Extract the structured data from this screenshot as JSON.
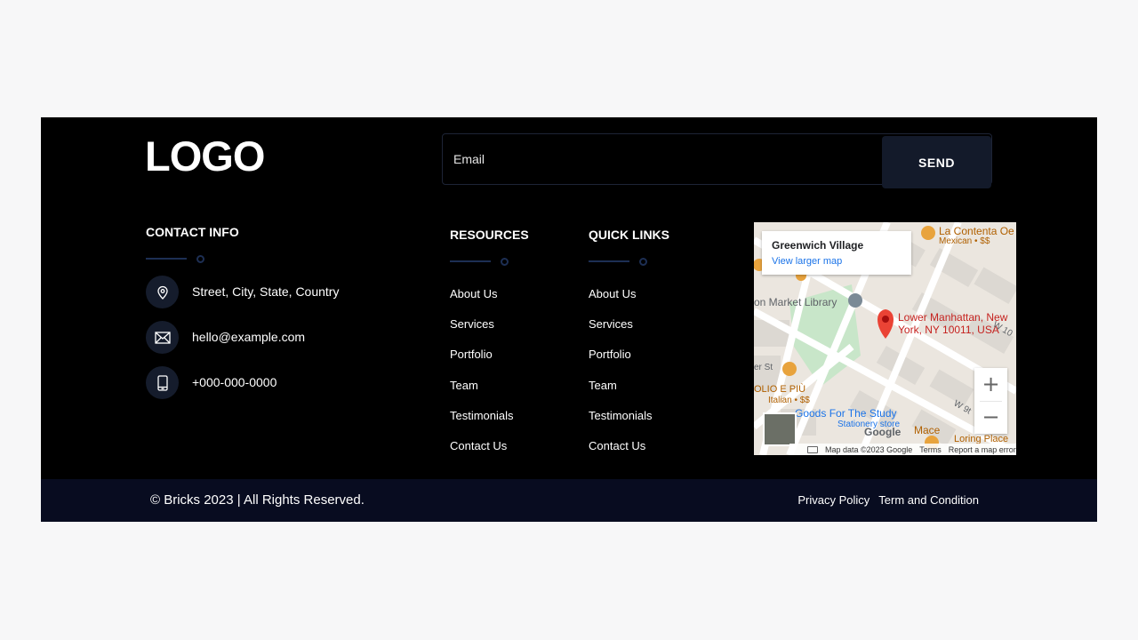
{
  "brand": {
    "logo": "LOGO"
  },
  "newsletter": {
    "email_placeholder": "Email",
    "send_label": "SEND"
  },
  "contact": {
    "title": "CONTACT INFO",
    "items": [
      {
        "icon": "map-pin-icon",
        "text": "Street, City, State, Country"
      },
      {
        "icon": "envelope-icon",
        "text": "hello@example.com"
      },
      {
        "icon": "phone-icon",
        "text": "+000-000-0000"
      }
    ]
  },
  "resources": {
    "title": "RESOURCES",
    "links": [
      "About Us",
      "Services",
      "Portfolio",
      "Team",
      "Testimonials",
      "Contact Us"
    ]
  },
  "quick_links": {
    "title": "QUICK LINKS",
    "links": [
      "About Us",
      "Services",
      "Portfolio",
      "Team",
      "Testimonials",
      "Contact Us"
    ]
  },
  "map": {
    "place_name": "Greenwich Village",
    "view_larger": "View larger map",
    "pin_label_line1": "Lower Manhattan, New",
    "pin_label_line2": "York, NY 10011, USA",
    "poi_library": "on Market Library",
    "poi_contenta": "La Contenta Oe",
    "poi_contenta_type": "Mexican • $$",
    "poi_goods": "Goods For The Study",
    "poi_goods_type": "Stationery store",
    "poi_olio": "OLIO E PIÙ",
    "poi_olio_type": "Italian • $$",
    "poi_mace": "Mace",
    "poi_loring": "Loring Place",
    "street_w9": "W 9t",
    "street_w10": "W 10",
    "street_er": "er St",
    "google": "Google",
    "map_data": "Map data ©2023 Google",
    "terms": "Terms",
    "report": "Report a map error",
    "zoom_in": "+",
    "zoom_out": "−",
    "colors": {
      "pin": "#ea4335",
      "label_red": "#c5221f",
      "poi_orange": "#e8a33d",
      "park": "#c8e6c9",
      "link_blue": "#1a73e8"
    }
  },
  "bottom": {
    "copyright": "© Bricks 2023 | All Rights Reserved.",
    "privacy": "Privacy Policy",
    "terms": "Term and Condition"
  },
  "colors": {
    "footer_bg": "#000000",
    "bottom_bar_bg": "#080c20",
    "button_bg": "#131a2a",
    "accent_line": "#1d2f54",
    "page_bg": "#f7f7f8"
  }
}
